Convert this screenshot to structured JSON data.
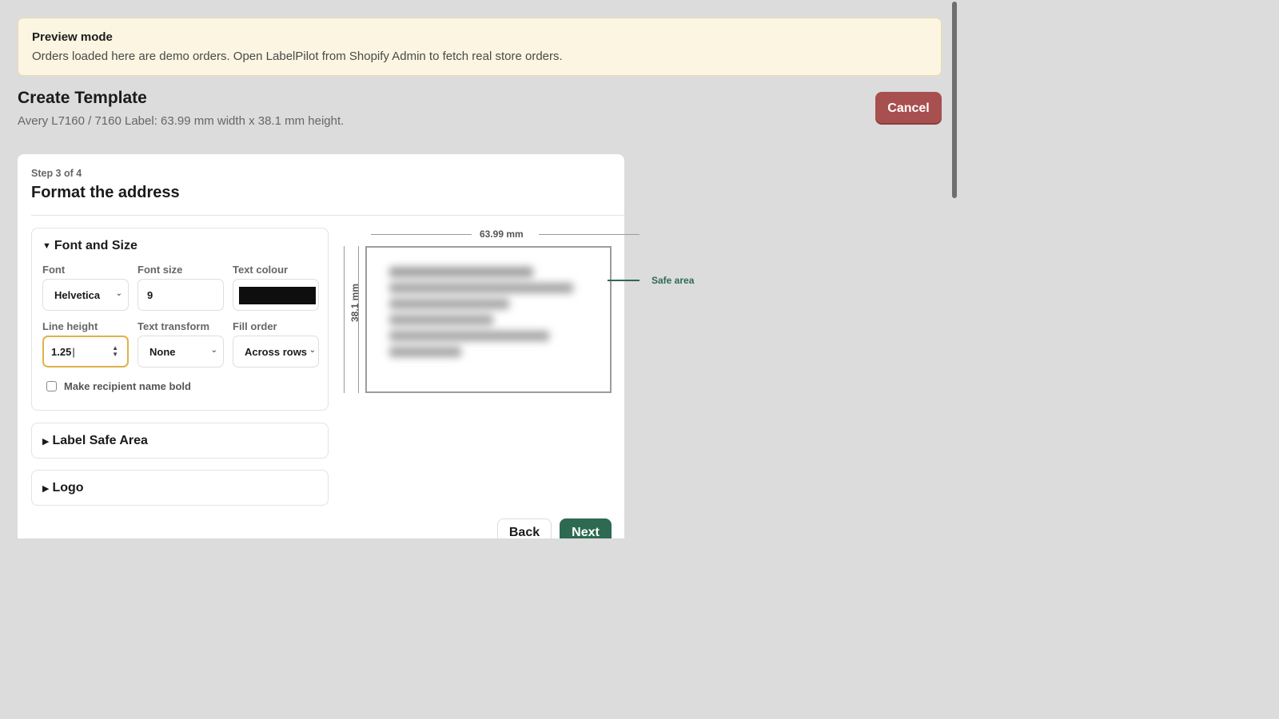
{
  "banner": {
    "title": "Preview mode",
    "text": "Orders loaded here are demo orders. Open LabelPilot from Shopify Admin to fetch real store orders."
  },
  "header": {
    "title": "Create Template",
    "subtitle": "Avery L7160 / 7160 Label: 63.99 mm width x 38.1 mm height.",
    "cancel_label": "Cancel"
  },
  "step": {
    "label": "Step 3 of 4",
    "title": "Format the address"
  },
  "font_panel": {
    "title": "Font and Size",
    "font_label": "Font",
    "font_value": "Helvetica",
    "font_size_label": "Font size",
    "font_size_value": "9",
    "text_colour_label": "Text colour",
    "text_colour": "#0e0e0e",
    "line_height_label": "Line height",
    "line_height_value": "1.25",
    "text_transform_label": "Text transform",
    "text_transform_value": "None",
    "fill_order_label": "Fill order",
    "fill_order_value": "Across rows",
    "bold_checkbox_label": "Make recipient name bold",
    "bold_checked": false
  },
  "sections": {
    "safe_area": "Label Safe Area",
    "logo": "Logo"
  },
  "preview": {
    "width_label": "63.99 mm",
    "height_label": "38.1 mm",
    "safe_area_label": "Safe area"
  },
  "footer": {
    "back_label": "Back",
    "next_label": "Next"
  },
  "colors": {
    "accent_green": "#2e6a52",
    "cancel_red": "#a84f4f",
    "banner_bg": "#fbf5e1",
    "focus_ring": "#e0b24a"
  },
  "icons": [
    "caret-down-icon",
    "caret-right-icon",
    "chevron-down-icon",
    "stepper-icon"
  ]
}
